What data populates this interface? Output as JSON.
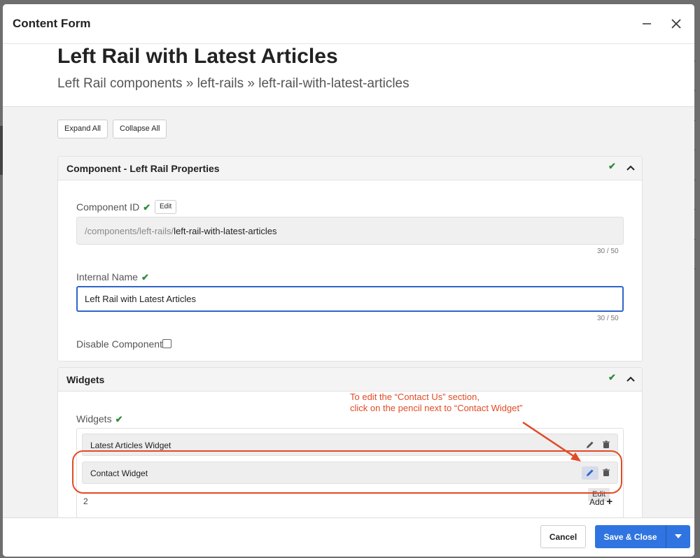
{
  "dialog": {
    "title": "Content Form",
    "minimize_icon": "minus-icon",
    "close_icon": "close-icon"
  },
  "page": {
    "title": "Left Rail with Latest Articles",
    "breadcrumb": "Left Rail components » left-rails » left-rail-with-latest-articles"
  },
  "toolbar": {
    "expand_all": "Expand All",
    "collapse_all": "Collapse All"
  },
  "component_panel": {
    "title": "Component - Left Rail Properties",
    "component_id_label": "Component ID",
    "edit_label": "Edit",
    "component_id_prefix": "/components/left-rails/",
    "component_id_value": "left-rail-with-latest-articles",
    "component_id_counter": "30 / 50",
    "internal_name_label": "Internal Name",
    "internal_name_value": "Left Rail with Latest Articles",
    "internal_name_counter": "30 / 50",
    "disable_label": "Disable Component"
  },
  "widgets_panel": {
    "title": "Widgets",
    "field_label": "Widgets",
    "items": [
      {
        "name": "Latest Articles Widget"
      },
      {
        "name": "Contact Widget"
      }
    ],
    "tooltip": "Edit",
    "count": "2",
    "add_label": "Add"
  },
  "annotation": {
    "line1": "To edit the “Contact Us” section,",
    "line2": "click on the pencil next to “Contact Widget”"
  },
  "footer": {
    "cancel": "Cancel",
    "save": "Save & Close"
  },
  "colors": {
    "accent": "#2f74e0",
    "focus": "#2f65c9",
    "annotation": "#e24a25",
    "success": "#2e8b3a"
  }
}
